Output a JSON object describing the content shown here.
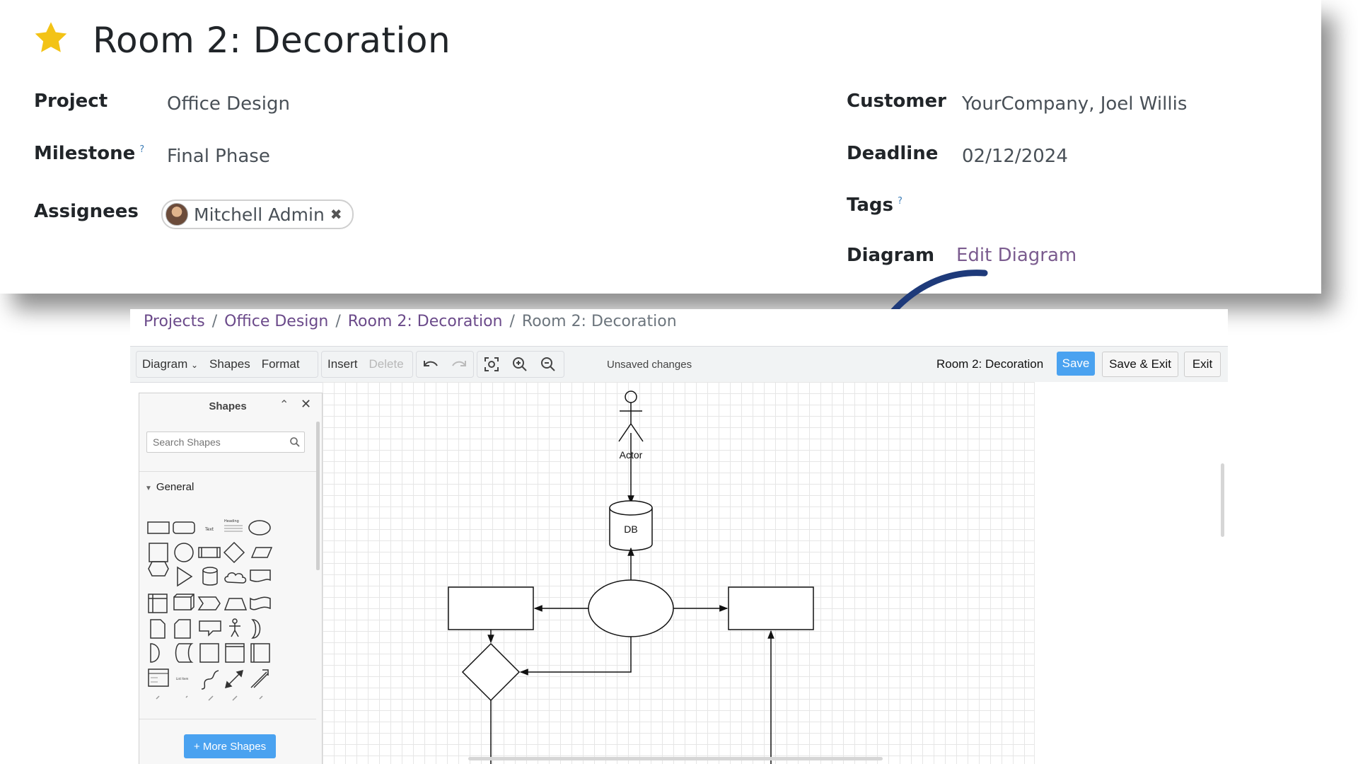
{
  "task": {
    "title": "Room 2: Decoration",
    "fields": {
      "project_label": "Project",
      "project_value": "Office Design",
      "milestone_label": "Milestone",
      "milestone_help": "?",
      "milestone_value": "Final Phase",
      "assignees_label": "Assignees",
      "assignee_name": "Mitchell Admin",
      "customer_label": "Customer",
      "customer_value": "YourCompany, Joel Willis",
      "deadline_label": "Deadline",
      "deadline_value": "02/12/2024",
      "tags_label": "Tags",
      "tags_help": "?",
      "diagram_label": "Diagram",
      "diagram_link": "Edit Diagram"
    }
  },
  "breadcrumb": [
    "Projects",
    "Office Design",
    "Room 2: Decoration",
    "Room 2: Decoration"
  ],
  "toolbar": {
    "diagram_menu": "Diagram",
    "shapes_menu": "Shapes",
    "format_menu": "Format",
    "insert": "Insert",
    "delete": "Delete",
    "status": "Unsaved changes",
    "diagram_name": "Room 2: Decoration",
    "save": "Save",
    "save_exit": "Save & Exit",
    "exit": "Exit"
  },
  "shapes_panel": {
    "title": "Shapes",
    "search_placeholder": "Search Shapes",
    "category": "General",
    "more_shapes": "+ More Shapes",
    "shape_text_label": "Text",
    "shape_heading_label": "Heading",
    "shape_listitem_label": "List Item"
  },
  "diagram": {
    "actor_label": "Actor",
    "db_label": "DB"
  },
  "colors": {
    "accent_blue": "#4aa2f0",
    "link_purple": "#6b4a8a",
    "star": "#f3c316",
    "arrow": "#1e3a7a"
  },
  "icons": [
    "star-icon",
    "search-icon",
    "undo-icon",
    "redo-icon",
    "fit-icon",
    "zoom-in-icon",
    "zoom-out-icon",
    "close-icon",
    "chevron-up-icon",
    "chevron-down-icon"
  ]
}
